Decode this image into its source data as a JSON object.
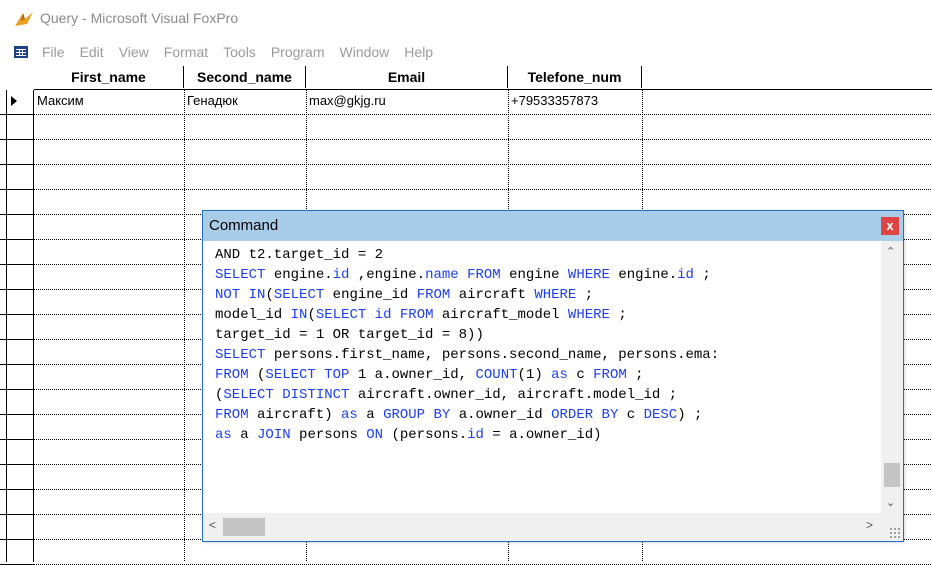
{
  "window": {
    "title": "Query - Microsoft Visual FoxPro"
  },
  "menu": [
    "File",
    "Edit",
    "View",
    "Format",
    "Tools",
    "Program",
    "Window",
    "Help"
  ],
  "grid": {
    "columns": [
      "First_name",
      "Second_name",
      "Email",
      "Telefone_num"
    ],
    "rows": [
      [
        "Максим",
        "Генадюк",
        "max@gkjg.ru",
        "+79533357873"
      ]
    ]
  },
  "command": {
    "title": "Command",
    "close_label": "x",
    "lines": [
      "AND t2.target_id = 2",
      "SELECT engine.id ,engine.name FROM engine WHERE engine.id ;",
      "NOT IN(SELECT engine_id FROM aircraft WHERE ;",
      "model_id IN(SELECT id FROM aircraft_model WHERE ;",
      "target_id = 1 OR target_id = 8))",
      "SELECT persons.first_name, persons.second_name, persons.ema:",
      "FROM (SELECT TOP 1 a.owner_id, COUNT(1) as c FROM ;",
      "(SELECT DISTINCT aircraft.owner_id, aircraft.model_id ;",
      "FROM aircraft) as a GROUP BY a.owner_id ORDER BY c DESC) ;",
      "as a JOIN persons ON (persons.id = a.owner_id)"
    ]
  },
  "icons": {
    "app": "foxpro-app-icon",
    "menu": "grid-menu-icon",
    "close": "close-icon"
  }
}
